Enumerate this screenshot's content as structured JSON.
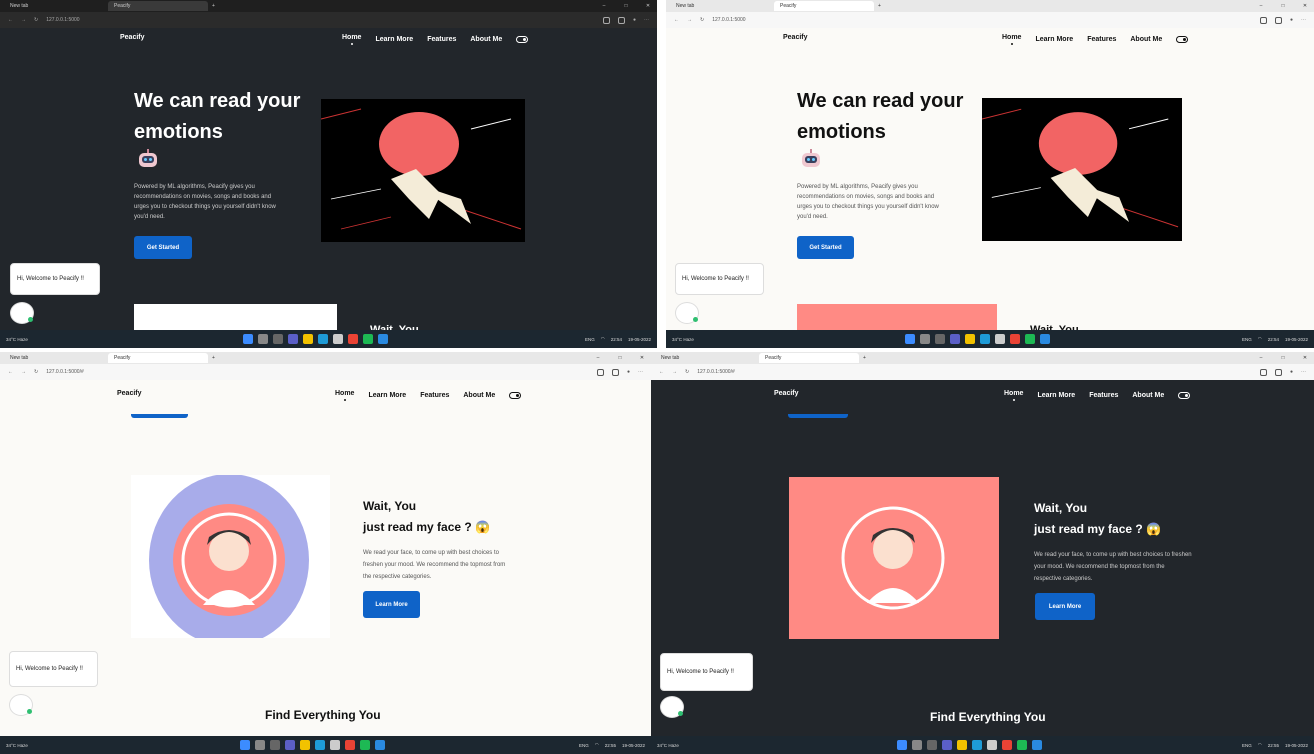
{
  "browser": {
    "tab_newtab": "New tab",
    "tab_peacify": "Peacify",
    "url_home": "127.0.0.1:5000",
    "url_hash": "127.0.0.1:5000/#"
  },
  "nav": {
    "brand": "Peacify",
    "home": "Home",
    "learn_more": "Learn More",
    "features": "Features",
    "about_me": "About Me"
  },
  "hero": {
    "title": "We can read your emotions",
    "description": "Powered by ML algorithms, Peacify gives you recommendations on movies, songs and books and urges you to checkout things you yourself didn't know you'd need.",
    "cta": "Get Started"
  },
  "section_face": {
    "title_line1": "Wait, You",
    "title_line2": "just read my face ? 😱",
    "description": "We read your face, to come up with best choices to freshen your mood. We recommend the topmost from the respective categories.",
    "cta": "Learn More"
  },
  "find_title": "Find Everything You",
  "partial_heading": "Wait, You",
  "chat": {
    "welcome": "Hi, Welcome to Peacify !!"
  },
  "taskbar": {
    "temp": "34°C",
    "weather": "Haze",
    "lang": "ENG",
    "region": "IN",
    "time_a": "22:54",
    "time_b": "22:55",
    "date": "19-05-2022"
  },
  "colors": {
    "accent": "#0f63c8",
    "salmon": "#ff8a84",
    "periwinkle": "#a8acea"
  }
}
